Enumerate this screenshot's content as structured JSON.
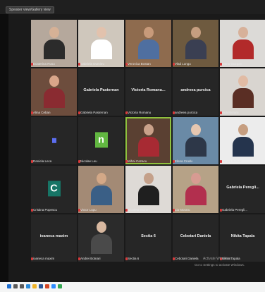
{
  "topbar": {
    "view_label": "Speaker view/Gallery view"
  },
  "grid": {
    "tiles": [
      {
        "type": "video",
        "name": "Ecaterina Rusu",
        "wall": "#b5a89c",
        "skin": "#d6b196",
        "shirt": "#2b2b2b"
      },
      {
        "type": "video",
        "name": "Gabriela Dumitru",
        "wall": "#cfc7bc",
        "skin": "#e2c2ad",
        "shirt": "#ffffff"
      },
      {
        "type": "video",
        "name": "Veronica Bostan",
        "wall": "#8e6b4e",
        "skin": "#c89a7a",
        "shirt": "#4f6fa0"
      },
      {
        "type": "video",
        "name": "Vlad Lungu",
        "wall": "#6e5a3f",
        "skin": "#c59e80",
        "shirt": "#3a3f52"
      },
      {
        "type": "video",
        "name": "Ioana Guzgan",
        "wall": "#dcdad7",
        "skin": "#d7b19a",
        "shirt": "#b22a2a"
      },
      {
        "type": "video",
        "name": "Alina Ceban",
        "wall": "#6d4d3d",
        "skin": "#d9a68a",
        "shirt": "#8a2b31"
      },
      {
        "type": "label",
        "name": "Gabriela Pasternan",
        "label": "Gabriela Pasternan"
      },
      {
        "type": "label",
        "name": "Victoria Romanu",
        "label": "Victoria Romanu..."
      },
      {
        "type": "label",
        "name": "andreea purcica",
        "label": "andreea purcica"
      },
      {
        "type": "video",
        "name": "Ana Moraru",
        "wall": "#d9d5d0",
        "skin": "#e1bba4",
        "shirt": "#5a2e24"
      },
      {
        "type": "avatar",
        "name": "Daniela Leca",
        "letter": "",
        "bg": "#5c6ef0",
        "size": 6
      },
      {
        "type": "avatar",
        "name": "Nicolae Leu",
        "letter": "n",
        "bg": "#62b741",
        "size": 18
      },
      {
        "type": "video",
        "name": "Mihai Cazacu",
        "wall": "#5a4032",
        "skin": "#c9a18a",
        "shirt": "#a72a33",
        "active": true
      },
      {
        "type": "video",
        "name": "Elena Crudu",
        "wall": "#6a8aa6",
        "skin": "#e6c7b0",
        "shirt": "#2d3748"
      },
      {
        "type": "video",
        "name": "Sergiu Botnari",
        "wall": "#ececec",
        "skin": "#c69e80",
        "shirt": "#25344d"
      },
      {
        "type": "avatar",
        "name": "Cristina Popescu",
        "letter": "C",
        "bg": "#177566",
        "size": 18
      },
      {
        "type": "video",
        "name": "Victor Lupu",
        "wall": "#a38a75",
        "skin": "#d3a887",
        "shirt": "#3a5f86"
      },
      {
        "type": "video",
        "name": "Nicoleta Guzun",
        "wall": "#dedad6",
        "skin": "#c4a08a",
        "shirt": "#1f1f1f"
      },
      {
        "type": "video",
        "name": "Lia Moraru",
        "wall": "#b6a287",
        "skin": "#d79b92",
        "shirt": "#b22f4e"
      },
      {
        "type": "label",
        "name": "Gabriela Peregli...",
        "label": "Gabriela Peregli..."
      },
      {
        "type": "label",
        "name": "ioaneca maxim",
        "label": "ioaneca maxim"
      },
      {
        "type": "video",
        "name": "Andrei Botnari",
        "wall": "#2b2b2b",
        "skin": "#d8b8a0",
        "shirt": "#4a4a4a"
      },
      {
        "type": "label",
        "name": "Sectia 6",
        "label": "Sectia 6"
      },
      {
        "type": "label",
        "name": "Cebotari Daniela",
        "label": "Cebotari Daniela"
      },
      {
        "type": "label",
        "name": "Nikita Tapala",
        "label": "Nikita Tapala"
      }
    ]
  },
  "footer": {
    "activate_title": "Activate Windows",
    "activate_sub": "Go to Settings to activate Windows."
  },
  "taskbar": {
    "icons": [
      {
        "name": "start-icon",
        "color": "#1e6fd0"
      },
      {
        "name": "search-icon",
        "color": "#5a5a5a"
      },
      {
        "name": "task-view-icon",
        "color": "#5a5a5a"
      },
      {
        "name": "edge-icon",
        "color": "#2d8bd8"
      },
      {
        "name": "explorer-icon",
        "color": "#f0b429"
      },
      {
        "name": "word-icon",
        "color": "#2b579a"
      },
      {
        "name": "powerpoint-icon",
        "color": "#d24726"
      },
      {
        "name": "zoom-icon",
        "color": "#2d8cff"
      },
      {
        "name": "chrome-icon",
        "color": "#34a853"
      }
    ]
  }
}
